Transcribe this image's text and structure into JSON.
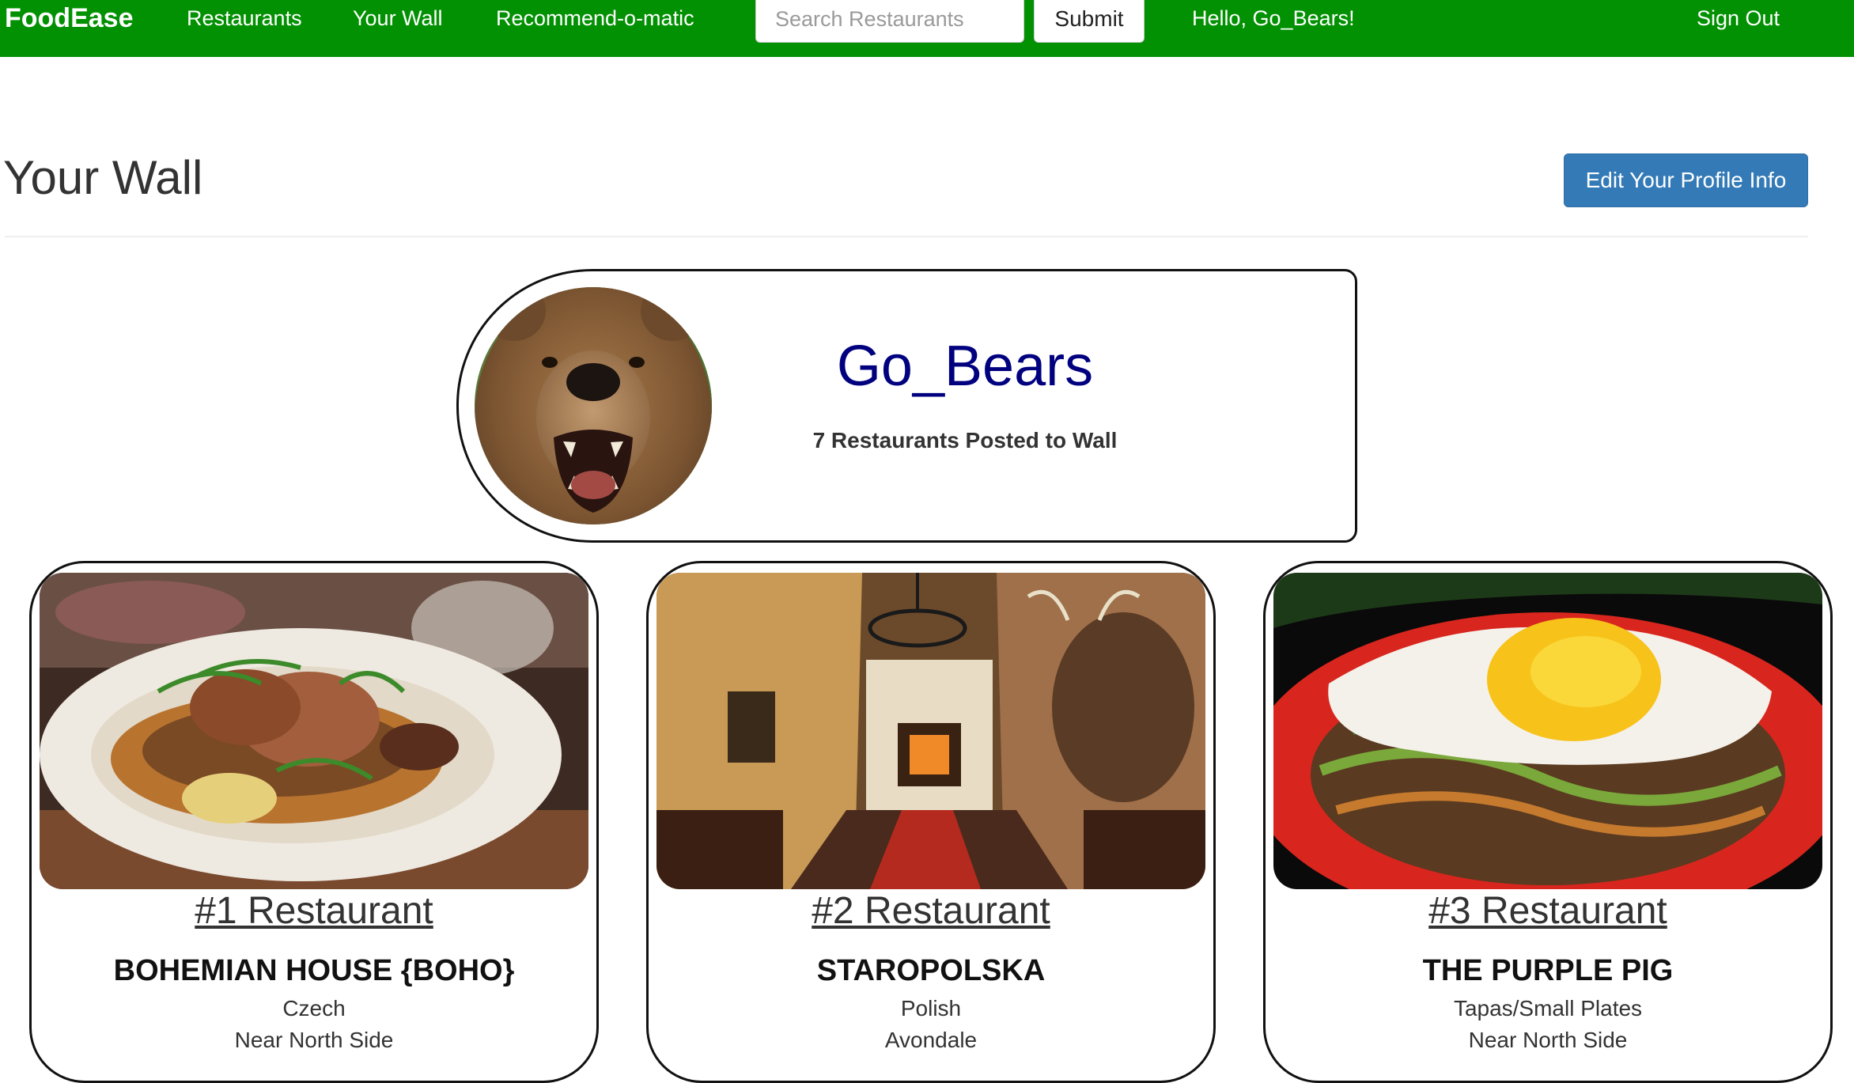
{
  "nav": {
    "brand": "FoodEase",
    "links": [
      "Restaurants",
      "Your Wall",
      "Recommend-o-matic"
    ],
    "search_placeholder": "Search Restaurants",
    "submit_label": "Submit",
    "greeting": "Hello, Go_Bears!",
    "sign_out": "Sign Out",
    "bar_color": "#029102"
  },
  "header": {
    "title": "Your Wall",
    "edit_button": "Edit Your Profile Info",
    "button_color": "#337ab7"
  },
  "profile": {
    "username": "Go_Bears",
    "posted_count": "7 Restaurants Posted to Wall",
    "name_color": "#010180"
  },
  "restaurants": [
    {
      "rank": "#1 Restaurant",
      "name": "BOHEMIAN HOUSE {BOHO}",
      "cuisine": "Czech",
      "area": "Near North Side"
    },
    {
      "rank": "#2 Restaurant",
      "name": "STAROPOLSKA",
      "cuisine": "Polish",
      "area": "Avondale"
    },
    {
      "rank": "#3 Restaurant",
      "name": "THE PURPLE PIG",
      "cuisine": "Tapas/Small Plates",
      "area": "Near North Side"
    }
  ]
}
